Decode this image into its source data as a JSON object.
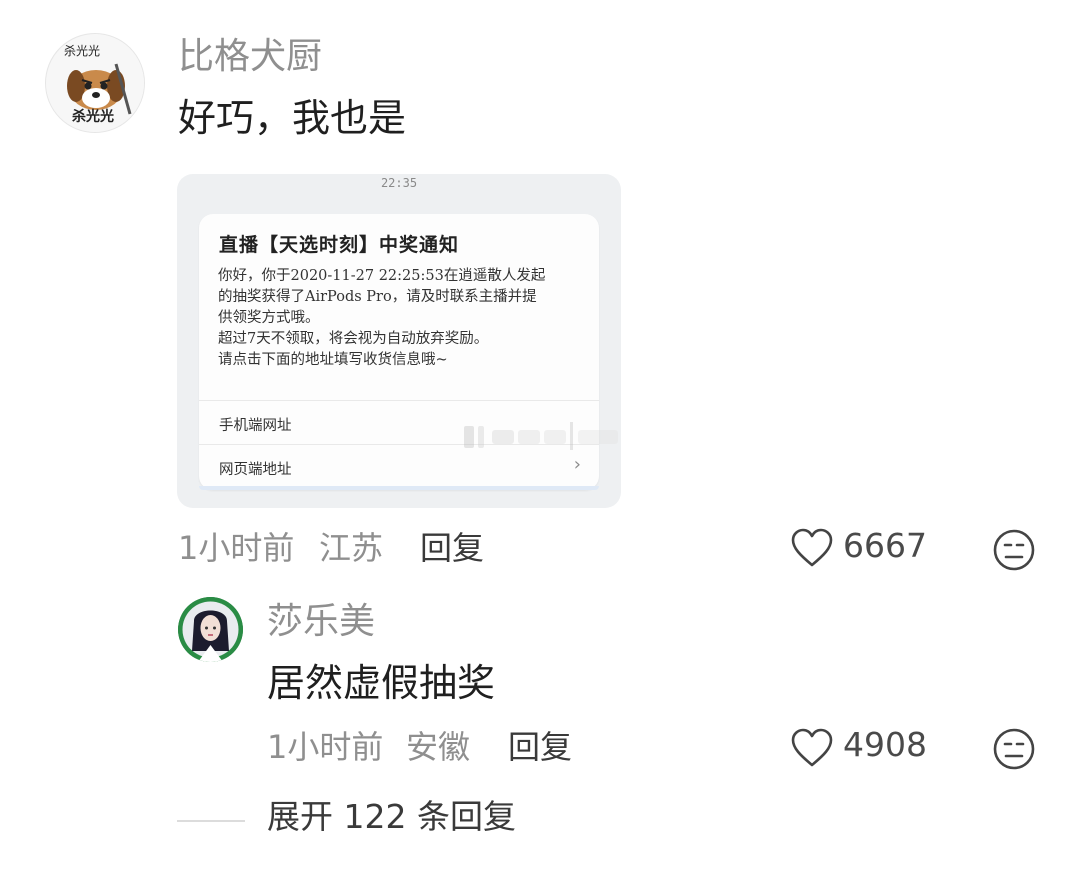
{
  "comment": {
    "author": "比格犬厨",
    "avatar_text": "杀光光",
    "text": "好巧，我也是",
    "attachment": {
      "time": "22:35",
      "title": "直播【天选时刻】中奖通知",
      "body_lines": [
        "你好，你于2020-11-27 22:25:53在逍遥散人发起",
        "的抽奖获得了AirPods Pro，请及时联系主播并提",
        "供领奖方式哦。",
        "超过7天不领取，将会视为自动放弃奖励。",
        "请点击下面的地址填写收货信息哦~"
      ],
      "link_mobile": "手机端网址",
      "link_web": "网页端地址"
    },
    "time": "1小时前",
    "location": "江苏",
    "reply_label": "回复",
    "likes": "6667"
  },
  "reply": {
    "author": "莎乐美",
    "text": "居然虚假抽奖",
    "time": "1小时前",
    "location": "安徽",
    "reply_label": "回复",
    "likes": "4908"
  },
  "expand": {
    "label": "展开 122 条回复"
  },
  "icons": {
    "like": "heart-outline-icon",
    "dislike": "neutral-face-icon"
  },
  "colors": {
    "muted": "#8f8f8f",
    "text": "#1f1f1f",
    "background": "#ffffff"
  }
}
